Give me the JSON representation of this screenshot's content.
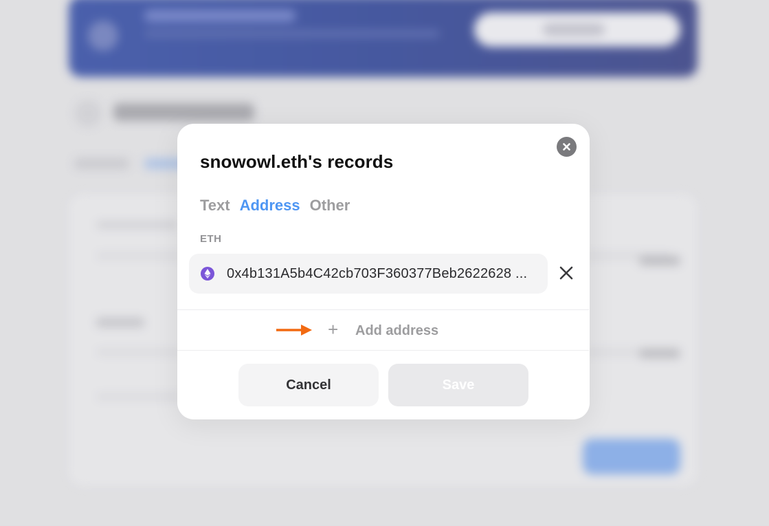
{
  "modal": {
    "title": "snowowl.eth's records",
    "tabs": [
      {
        "label": "Text",
        "active": false
      },
      {
        "label": "Address",
        "active": true
      },
      {
        "label": "Other",
        "active": false
      }
    ],
    "records": [
      {
        "coin": "ETH",
        "icon": "ethereum-icon",
        "value": "0x4b131A5b4C42cb703F360377Beb2622628 ..."
      }
    ],
    "add_label": "Add address",
    "cancel_label": "Cancel",
    "save_label": "Save"
  },
  "colors": {
    "accent": "#4e96f3",
    "eth_purple": "#7b55d8",
    "arrow": "#f26a12",
    "muted": "#9d9d9f"
  }
}
